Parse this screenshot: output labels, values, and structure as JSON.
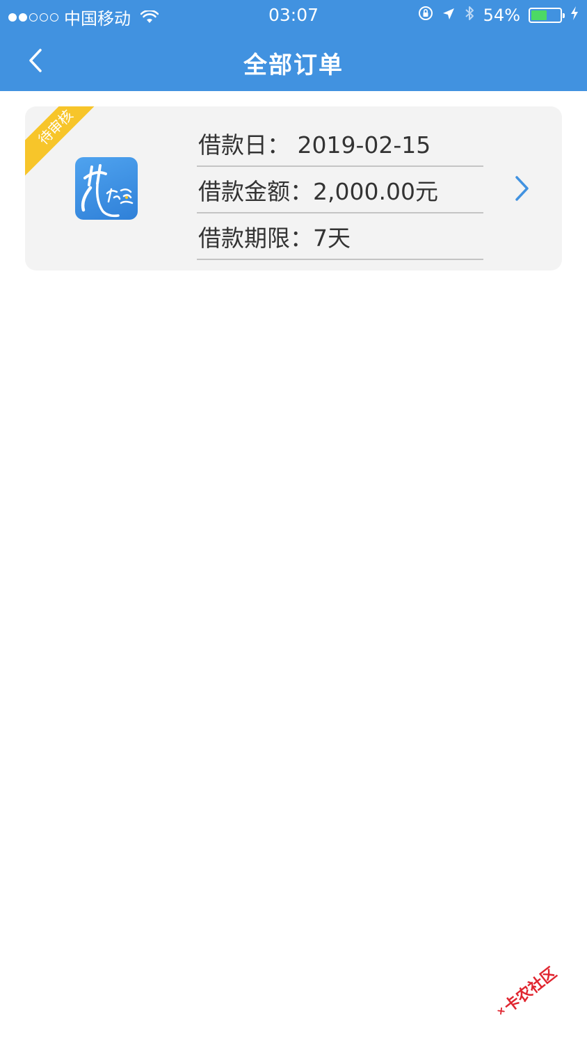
{
  "status_bar": {
    "carrier": "中国移动",
    "time": "03:07",
    "battery_percent": "54%",
    "battery_level": 0.54,
    "signal_bars_filled": 2,
    "signal_bars_total": 5
  },
  "nav": {
    "title": "全部订单"
  },
  "orders": [
    {
      "status_label": "待审核",
      "loan_date": "借款日：  2019-02-15",
      "loan_amount": "借款金额：2,000.00元",
      "loan_term": "借款期限：7天",
      "logo_text": "花无忌"
    }
  ],
  "watermark": {
    "text": "卡农社区"
  },
  "colors": {
    "header": "#4192e0",
    "card_bg": "#f3f3f3",
    "ribbon": "#f7c52a",
    "chevron": "#4192e0",
    "battery": "#4cd964",
    "watermark": "#e0252f"
  }
}
